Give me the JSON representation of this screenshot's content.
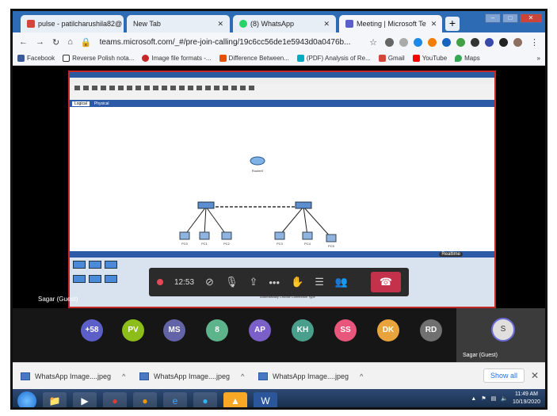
{
  "browser": {
    "tabs": [
      {
        "label": "pulse - patilcharushila82@",
        "icon_color": "#d44638"
      },
      {
        "label": "New Tab",
        "icon_color": "#e8eef6"
      },
      {
        "label": "(8) WhatsApp",
        "icon_color": "#25d366"
      },
      {
        "label": "Meeting | Microsoft Te",
        "icon_color": "#5b5fc7"
      }
    ],
    "new_tab": "+",
    "url": "teams.microsoft.com/_#/pre-join-calling/19c6cc56de1e5943d0a0476b...",
    "bookmarks": [
      {
        "label": "Facebook",
        "color": "#3b5998"
      },
      {
        "label": "Reverse Polish nota...",
        "color": "#ffffff"
      },
      {
        "label": "Image file formats -...",
        "color": "#c62828"
      },
      {
        "label": "Difference Between...",
        "color": "#e65100"
      },
      {
        "label": "(PDF) Analysis of Re...",
        "color": "#00acc1"
      },
      {
        "label": "Gmail",
        "color": "#d44638"
      },
      {
        "label": "YouTube",
        "color": "#ff0000"
      },
      {
        "label": "Maps",
        "color": "#34a853"
      }
    ]
  },
  "packet_tracer": {
    "logical_tab": "Logical",
    "physical_tab": "Physical",
    "router_label": "Router0",
    "pcs_left": [
      "PC0",
      "PC1",
      "PC2"
    ],
    "pcs_right": [
      "PC3",
      "PC4",
      "PC5"
    ],
    "realtime": "Realtime",
    "auto_connection": "Automatically Choose Connection Type"
  },
  "call": {
    "duration": "12:53",
    "guest_label": "Sagar (Guest)"
  },
  "participants": [
    {
      "initials": "+58",
      "color": "#5b5fc7"
    },
    {
      "initials": "PV",
      "color": "#8cbd18"
    },
    {
      "initials": "MS",
      "color": "#6264a7"
    },
    {
      "initials": "8",
      "color": "#5db38a"
    },
    {
      "initials": "AP",
      "color": "#7a5fc7"
    },
    {
      "initials": "KH",
      "color": "#4a9f8c"
    },
    {
      "initials": "SS",
      "color": "#e8567b"
    },
    {
      "initials": "DK",
      "color": "#e8a33d"
    },
    {
      "initials": "RD",
      "color": "#707070"
    }
  ],
  "self": {
    "initials": "S",
    "name": "Sagar (Guest)"
  },
  "downloads": [
    {
      "label": "WhatsApp Image....jpeg"
    },
    {
      "label": "WhatsApp Image....jpeg"
    },
    {
      "label": "WhatsApp Image....jpeg"
    }
  ],
  "show_all": "Show all",
  "clock": {
    "time": "11:49 AM",
    "date": "10/19/2020"
  }
}
